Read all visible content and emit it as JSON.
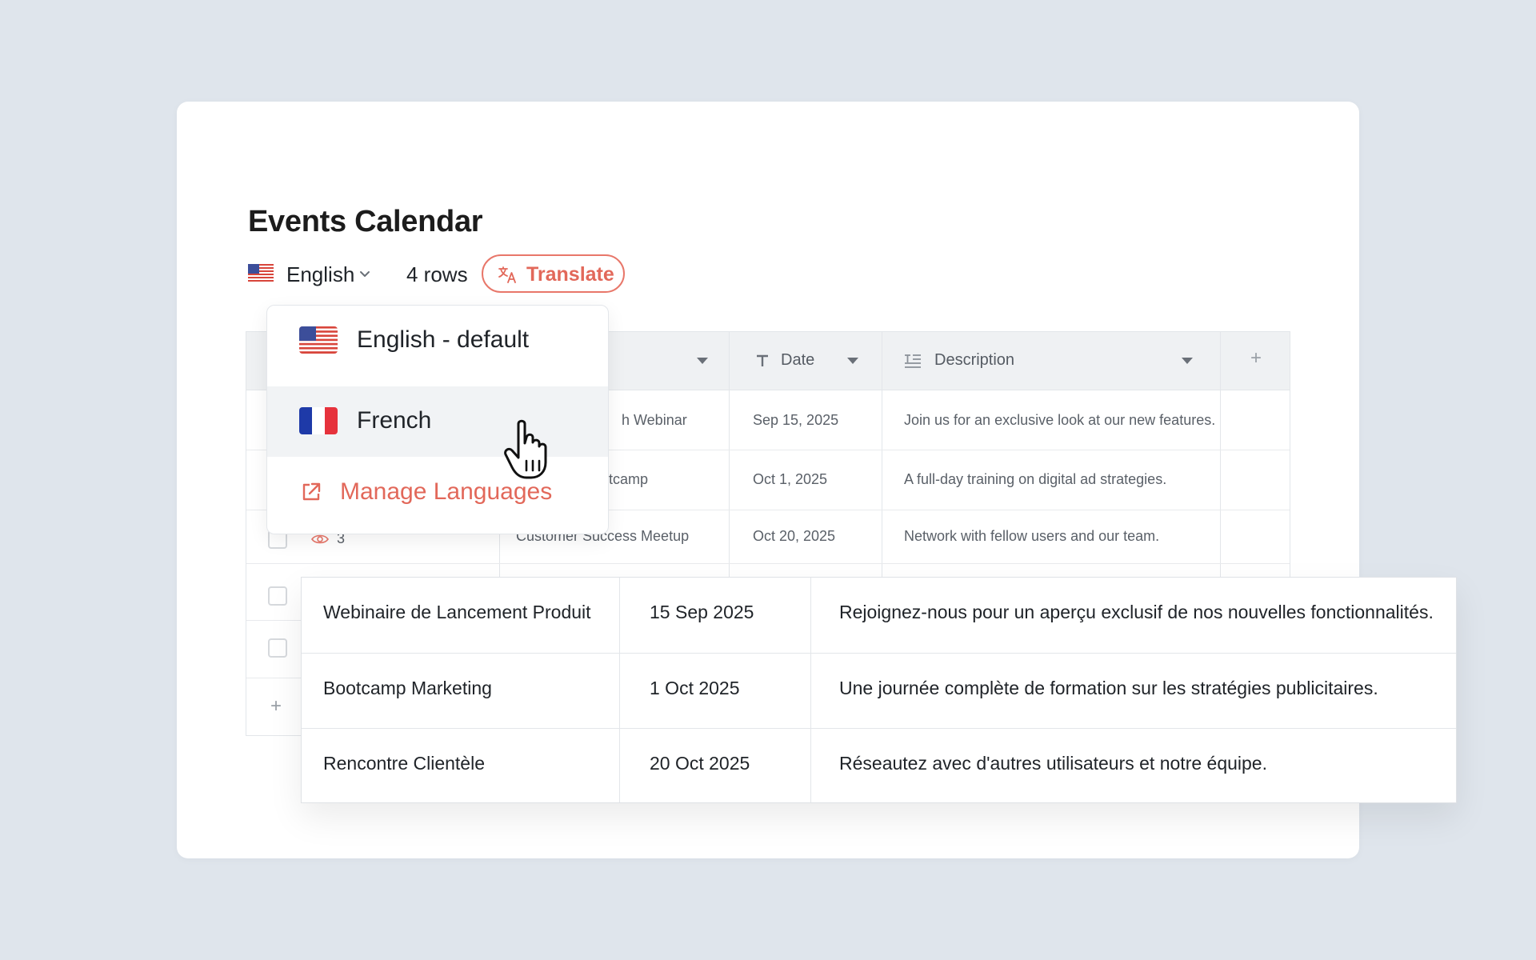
{
  "page": {
    "title": "Events Calendar"
  },
  "toolbar": {
    "language": "English",
    "rows": "4 rows",
    "translate_label": "Translate"
  },
  "colors": {
    "accent": "#e2685a",
    "background": "#dfe5ec",
    "header_bg": "#eff1f3"
  },
  "table": {
    "columns": {
      "date": "Date",
      "description": "Description",
      "add": "+"
    },
    "rows": [
      {
        "name": "h Webinar",
        "date": "Sep 15, 2025",
        "description": "Join us for an exclusive look at our new features."
      },
      {
        "name": "tcamp",
        "date": "Oct 1, 2025",
        "description": "A full-day training on digital ad strategies."
      },
      {
        "name": "Customer Success Meetup",
        "date": "Oct 20, 2025",
        "description": "Network with fellow users and our team.",
        "row_number": "3"
      }
    ],
    "add_row": "+"
  },
  "dropdown": {
    "items": [
      {
        "label": "English - default",
        "icon": "us-flag-icon"
      },
      {
        "label": "French",
        "icon": "france-flag-icon"
      }
    ],
    "manage_label": "Manage Languages",
    "manage_icon": "external-link-icon"
  },
  "translation_table": {
    "rows": [
      {
        "name": "Webinaire de Lancement Produit",
        "date": "15 Sep 2025",
        "description": "Rejoignez-nous pour un aperçu exclusif de nos nouvelles fonctionnalités."
      },
      {
        "name": "Bootcamp Marketing",
        "date": "1 Oct 2025",
        "description": "Une journée complète de formation sur les stratégies publicitaires."
      },
      {
        "name": "Rencontre Clientèle",
        "date": "20 Oct 2025",
        "description": "Réseautez avec d'autres utilisateurs et notre équipe."
      }
    ]
  }
}
